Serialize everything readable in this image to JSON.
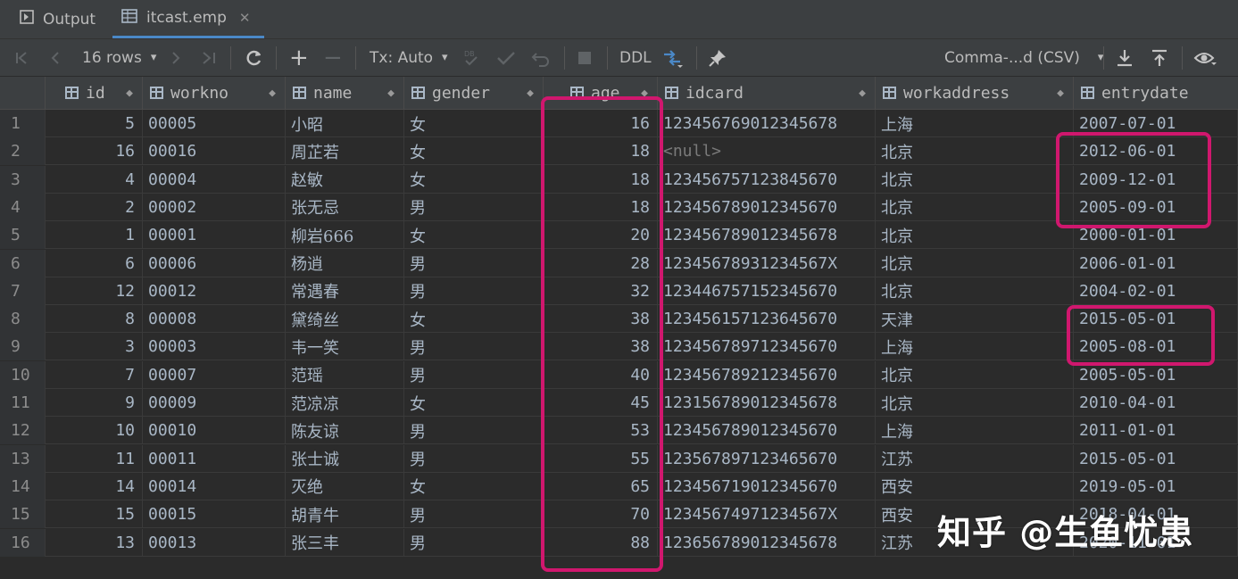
{
  "tabs": [
    {
      "label": "Output"
    },
    {
      "label": "itcast.emp"
    }
  ],
  "toolbar": {
    "rows_label": "16 rows",
    "tx_label": "Tx: Auto",
    "ddl_label": "DDL",
    "export_format": "Comma-...d (CSV)"
  },
  "columns": [
    "id",
    "workno",
    "name",
    "gender",
    "age",
    "idcard",
    "workaddress",
    "entrydate"
  ],
  "rows": [
    {
      "n": "1",
      "id": "5",
      "workno": "00005",
      "name": "小昭",
      "gender": "女",
      "age": "16",
      "idcard": "123456769012345678",
      "workaddress": "上海",
      "entrydate": "2007-07-01"
    },
    {
      "n": "2",
      "id": "16",
      "workno": "00016",
      "name": "周芷若",
      "gender": "女",
      "age": "18",
      "idcard": "<null>",
      "workaddress": "北京",
      "entrydate": "2012-06-01"
    },
    {
      "n": "3",
      "id": "4",
      "workno": "00004",
      "name": "赵敏",
      "gender": "女",
      "age": "18",
      "idcard": "123456757123845670",
      "workaddress": "北京",
      "entrydate": "2009-12-01"
    },
    {
      "n": "4",
      "id": "2",
      "workno": "00002",
      "name": "张无忌",
      "gender": "男",
      "age": "18",
      "idcard": "123456789012345670",
      "workaddress": "北京",
      "entrydate": "2005-09-01"
    },
    {
      "n": "5",
      "id": "1",
      "workno": "00001",
      "name": "柳岩666",
      "gender": "女",
      "age": "20",
      "idcard": "123456789012345678",
      "workaddress": "北京",
      "entrydate": "2000-01-01"
    },
    {
      "n": "6",
      "id": "6",
      "workno": "00006",
      "name": "杨逍",
      "gender": "男",
      "age": "28",
      "idcard": "12345678931234567X",
      "workaddress": "北京",
      "entrydate": "2006-01-01"
    },
    {
      "n": "7",
      "id": "12",
      "workno": "00012",
      "name": "常遇春",
      "gender": "男",
      "age": "32",
      "idcard": "123446757152345670",
      "workaddress": "北京",
      "entrydate": "2004-02-01"
    },
    {
      "n": "8",
      "id": "8",
      "workno": "00008",
      "name": "黛绮丝",
      "gender": "女",
      "age": "38",
      "idcard": "123456157123645670",
      "workaddress": "天津",
      "entrydate": "2015-05-01"
    },
    {
      "n": "9",
      "id": "3",
      "workno": "00003",
      "name": "韦一笑",
      "gender": "男",
      "age": "38",
      "idcard": "123456789712345670",
      "workaddress": "上海",
      "entrydate": "2005-08-01"
    },
    {
      "n": "10",
      "id": "7",
      "workno": "00007",
      "name": "范瑶",
      "gender": "男",
      "age": "40",
      "idcard": "123456789212345670",
      "workaddress": "北京",
      "entrydate": "2005-05-01"
    },
    {
      "n": "11",
      "id": "9",
      "workno": "00009",
      "name": "范凉凉",
      "gender": "女",
      "age": "45",
      "idcard": "123156789012345678",
      "workaddress": "北京",
      "entrydate": "2010-04-01"
    },
    {
      "n": "12",
      "id": "10",
      "workno": "00010",
      "name": "陈友谅",
      "gender": "男",
      "age": "53",
      "idcard": "123456789012345670",
      "workaddress": "上海",
      "entrydate": "2011-01-01"
    },
    {
      "n": "13",
      "id": "11",
      "workno": "00011",
      "name": "张士诚",
      "gender": "男",
      "age": "55",
      "idcard": "123567897123465670",
      "workaddress": "江苏",
      "entrydate": "2015-05-01"
    },
    {
      "n": "14",
      "id": "14",
      "workno": "00014",
      "name": "灭绝",
      "gender": "女",
      "age": "65",
      "idcard": "123456719012345670",
      "workaddress": "西安",
      "entrydate": "2019-05-01"
    },
    {
      "n": "15",
      "id": "15",
      "workno": "00015",
      "name": "胡青牛",
      "gender": "男",
      "age": "70",
      "idcard": "12345674971234567X",
      "workaddress": "西安",
      "entrydate": "2018-04-01"
    },
    {
      "n": "16",
      "id": "13",
      "workno": "00013",
      "name": "张三丰",
      "gender": "男",
      "age": "88",
      "idcard": "123656789012345678",
      "workaddress": "江苏",
      "entrydate": "2020-11-01"
    }
  ],
  "watermark": "知乎 @生鱼忧患",
  "colors": {
    "highlight": "#d0176e",
    "accent": "#4a88c7",
    "background": "#2b2b2b"
  }
}
